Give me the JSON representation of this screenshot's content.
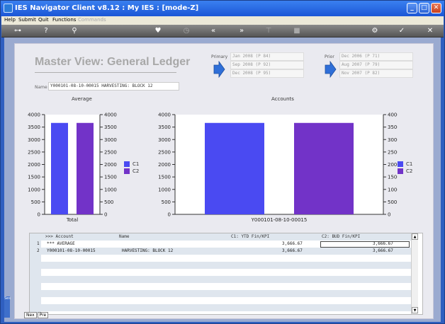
{
  "window": {
    "title": "IES Navigator Client v8.12 : My IES :      [mode-Z]"
  },
  "menu": {
    "items": [
      "Help",
      "Submit",
      "Quit",
      "Functions"
    ],
    "disabled_item": "Commands"
  },
  "page": {
    "title": "Master View: General Ledger",
    "name_label": "Name",
    "name_value": "Y000101-08-10-00015 HARVESTING: BLOCK 12",
    "primary_label": "Primary",
    "primary_periods": [
      "Jan 2008 (P 84)",
      "Sep 2008 (P 92)",
      "Dec 2008 (P 95)"
    ],
    "prior_label": "Prior",
    "prior_periods": [
      "Dec 2006 (P 71)",
      "Aug 2007 (P 79)",
      "Nov 2007 (P 82)"
    ]
  },
  "charts": {
    "left_title": "Average",
    "right_title": "Accounts"
  },
  "chart_data": [
    {
      "type": "bar",
      "title": "Average",
      "categories": [
        "Total"
      ],
      "series": [
        {
          "name": "C1",
          "values": [
            3666.67
          ]
        },
        {
          "name": "C2",
          "values": [
            3666.67
          ]
        }
      ],
      "ylim": [
        0,
        4000
      ],
      "yticks": [
        0,
        500,
        1000,
        1500,
        2000,
        2500,
        3000,
        3500,
        4000
      ],
      "colors": [
        "#4a4af2",
        "#7233c8"
      ],
      "legend": "right"
    },
    {
      "type": "bar",
      "title": "Accounts",
      "categories": [
        "Y000101-08-10-00015"
      ],
      "series": [
        {
          "name": "C1",
          "values": [
            3666.67
          ]
        },
        {
          "name": "C2",
          "values": [
            3666.67
          ]
        }
      ],
      "ylim": [
        0,
        4000
      ],
      "yticks": [
        0,
        500,
        1000,
        1500,
        2000,
        2500,
        3000,
        3500,
        4000
      ],
      "colors": [
        "#4a4af2",
        "#7233c8"
      ],
      "legend": "right"
    }
  ],
  "grid": {
    "headers": [
      ">>> Account",
      "Name",
      "C1: YTD Fin/KPI",
      "C2: BUD Fin/KPI"
    ],
    "rows": [
      {
        "num": "1",
        "account": "*** AVERAGE",
        "name": "",
        "c1": "3,666.67",
        "c2": "3,666.67"
      },
      {
        "num": "2",
        "account": "Y000101-08-10-00015",
        "name": "HARVESTING: BLOCK 12",
        "c1": "3,666.67",
        "c2": "3,666.67"
      }
    ]
  },
  "nav": {
    "next": "Nex",
    "prev": "Pre"
  },
  "side_tab": "Ses"
}
